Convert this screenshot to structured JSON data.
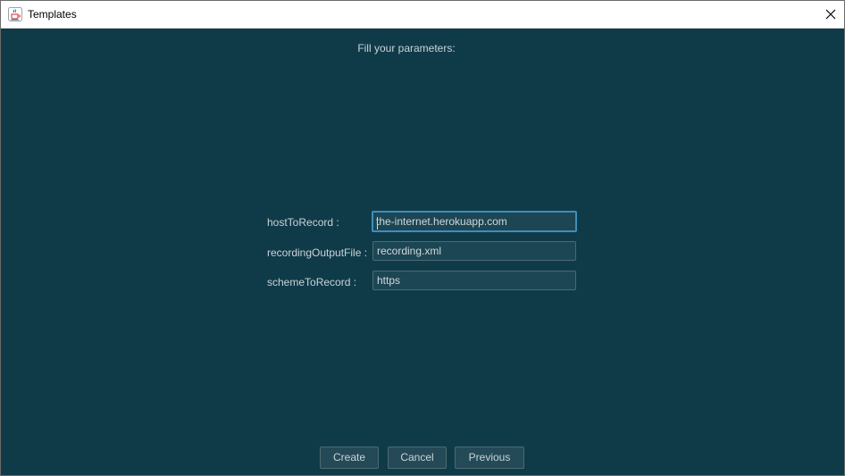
{
  "window": {
    "title": "Templates"
  },
  "heading": "Fill your parameters:",
  "parameters": [
    {
      "label": "hostToRecord :",
      "value": "the-internet.herokuapp.com"
    },
    {
      "label": "recordingOutputFile :",
      "value": "recording.xml"
    },
    {
      "label": "schemeToRecord :",
      "value": "https"
    }
  ],
  "buttons": {
    "create": "Create",
    "cancel": "Cancel",
    "previous": "Previous"
  },
  "icons": {
    "app": "java-cup-icon",
    "close": "close-icon"
  },
  "colors": {
    "background": "#0f3b49",
    "field": "#1d4654",
    "focus_border": "#3f8dbd",
    "text": "#c9d3d7"
  }
}
